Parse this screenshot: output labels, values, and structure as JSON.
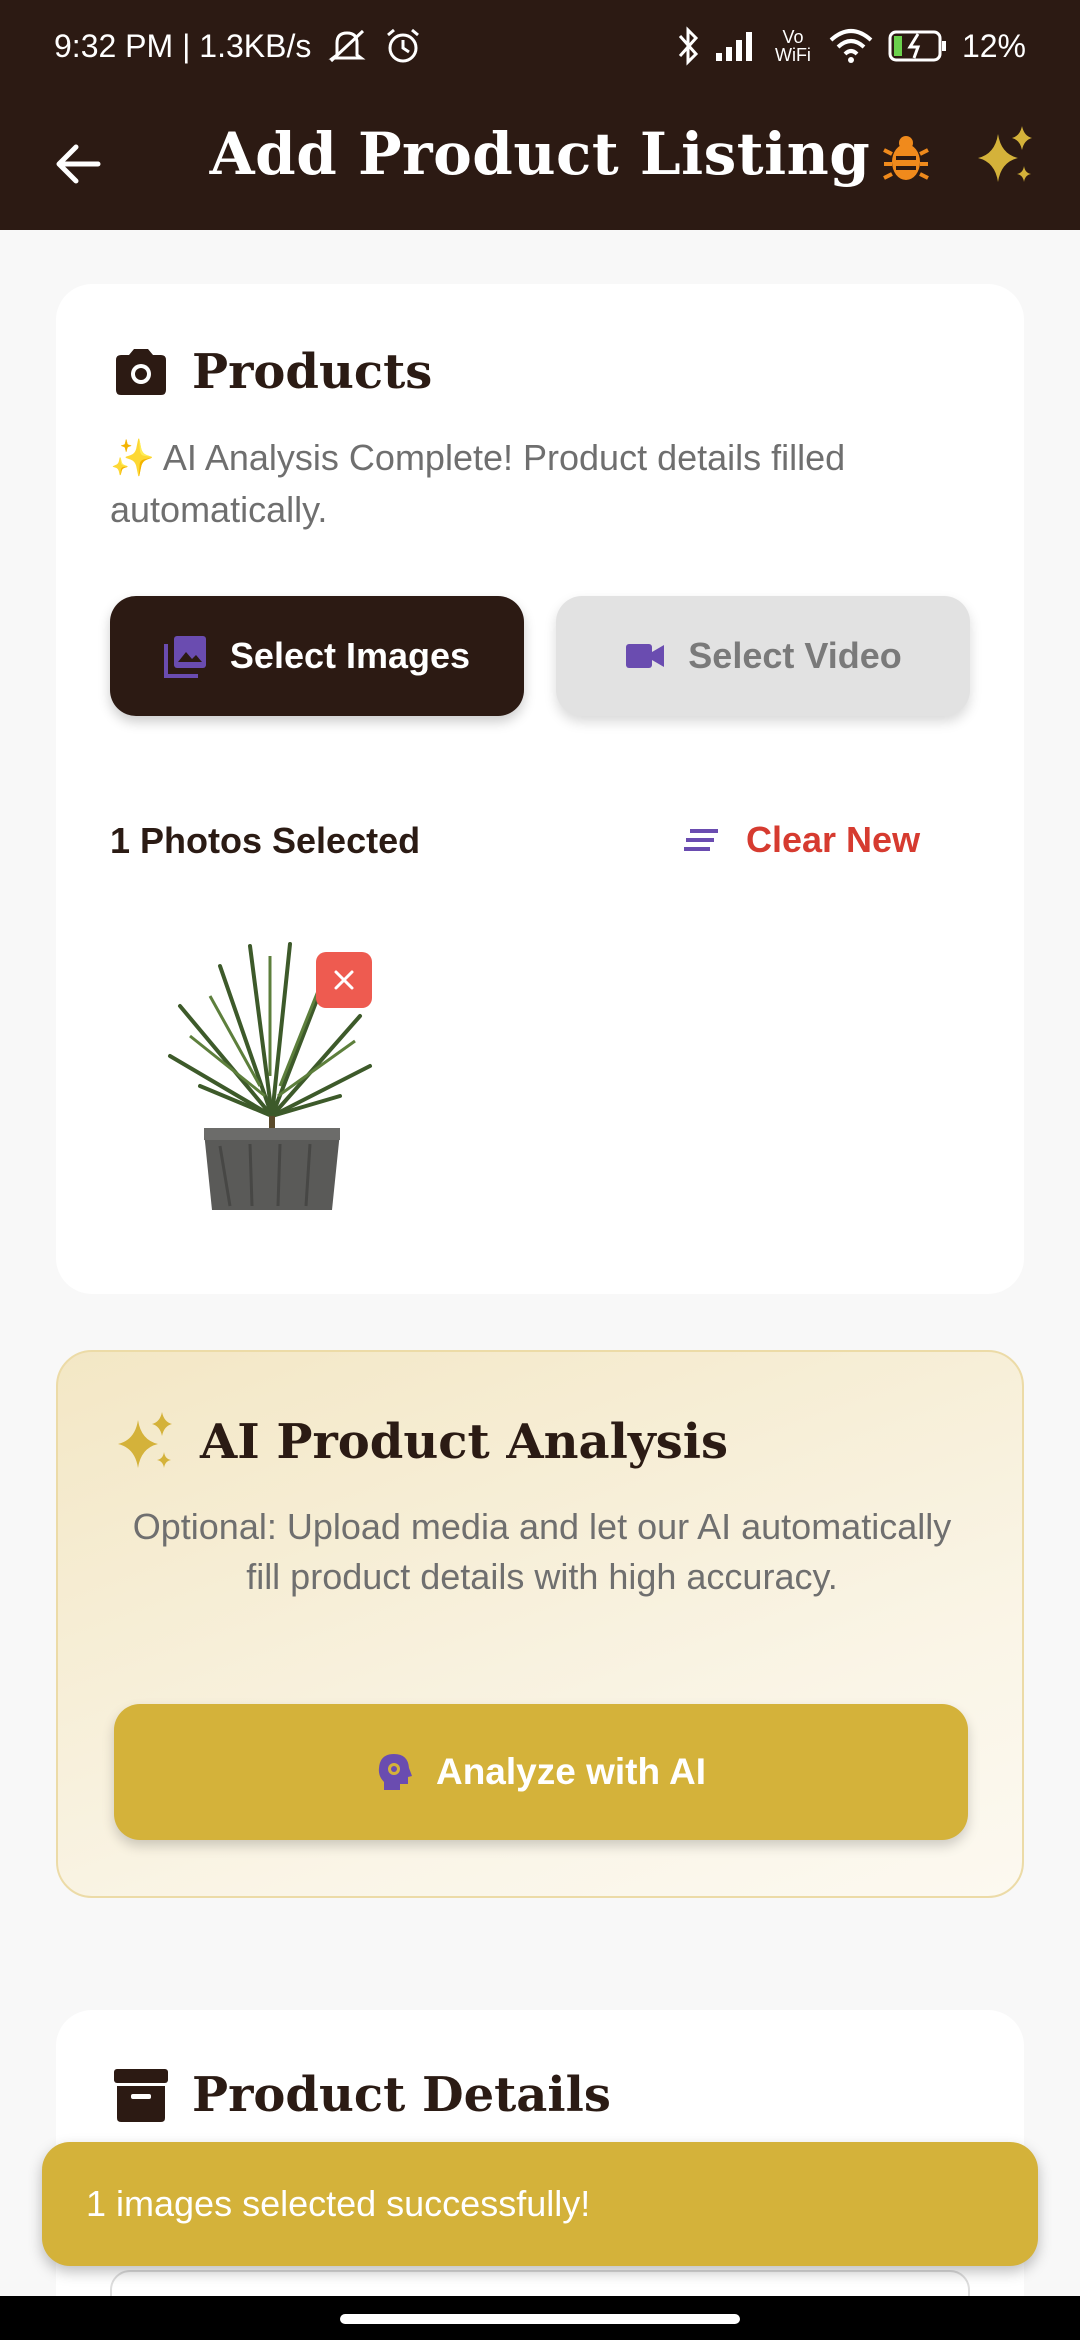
{
  "status_bar": {
    "left_text": "9:32 PM | 1.3KB/s",
    "vowifi_label": "Vo WiFi",
    "battery": "12%"
  },
  "app_bar": {
    "title": "Add Product Listing",
    "icons": [
      "back-arrow-icon",
      "bug-icon",
      "sparkle-icon"
    ],
    "bug_color": "#f08a1c",
    "sparkle_color": "#d4b23a"
  },
  "products_card": {
    "title": "Products",
    "ai_status": "✨ AI Analysis Complete! Product details filled automatically.",
    "select_images_label": "Select Images",
    "select_video_label": "Select Video",
    "photos_selected": "1 Photos Selected",
    "clear_label": "Clear New"
  },
  "ai_card": {
    "title": "AI Product Analysis",
    "description": "Optional: Upload media and let our AI automatically fill product details with high accuracy.",
    "button_label": "Analyze with AI"
  },
  "details_card": {
    "title": "Product Details"
  },
  "toast": {
    "message": "1 images selected successfully!"
  },
  "colors": {
    "brand_dark": "#2c1a13",
    "gold": "#d4b23a",
    "accent_purple": "#6a4cb0",
    "danger": "#d63b30"
  }
}
